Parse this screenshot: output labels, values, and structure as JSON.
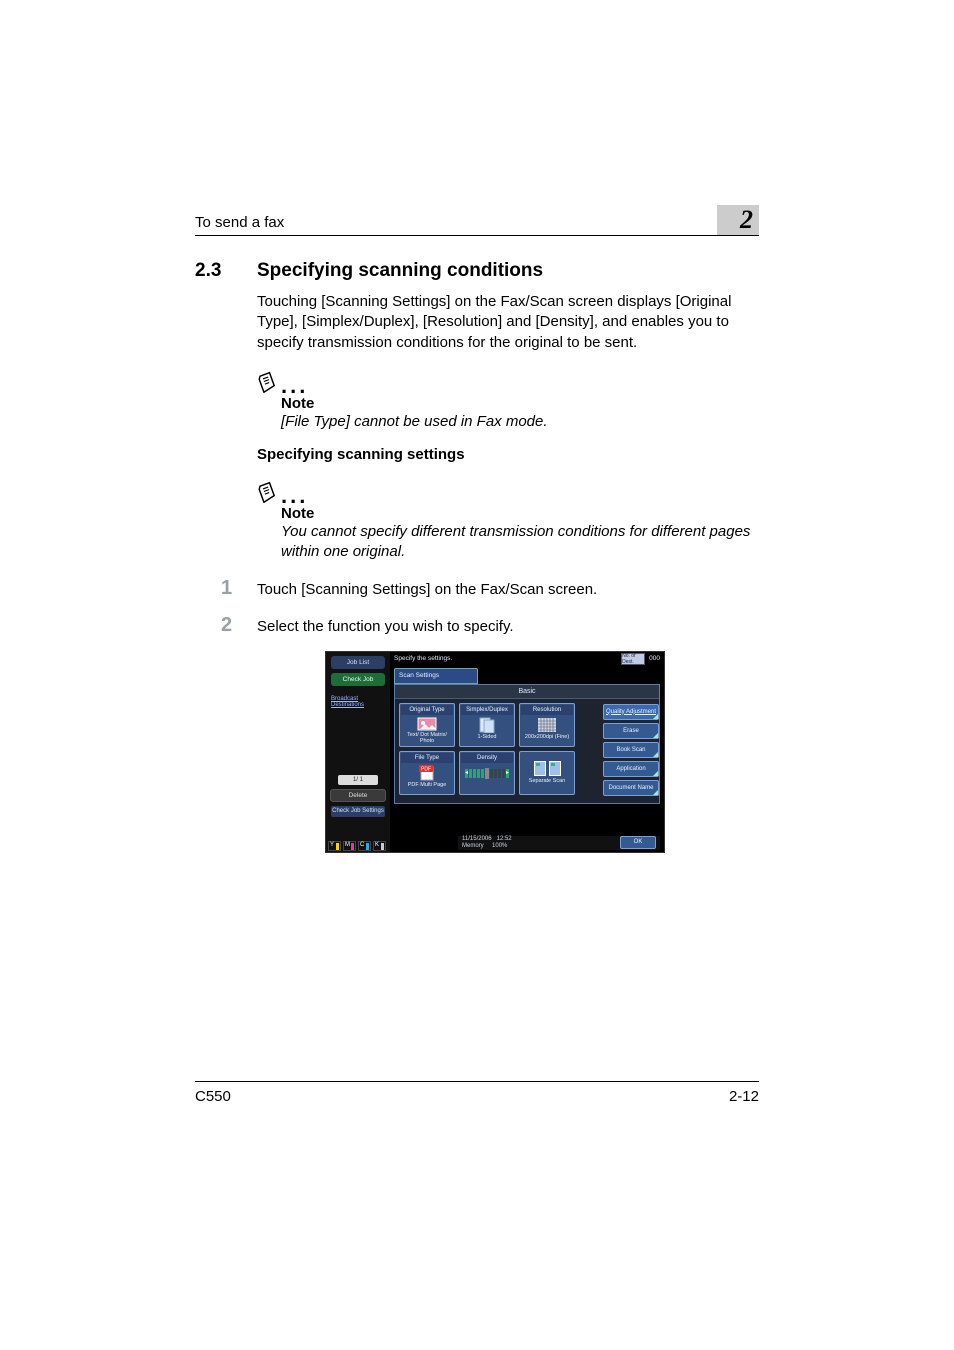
{
  "header": {
    "running_title": "To send a fax",
    "chapter_number": "2"
  },
  "section": {
    "number": "2.3",
    "title": "Specifying scanning conditions"
  },
  "intro_paragraph": "Touching [Scanning Settings] on the Fax/Scan screen displays [Original Type], [Simplex/Duplex], [Resolution] and [Density], and enables you to specify transmission conditions for the original to be sent.",
  "note1": {
    "label": "Note",
    "body": "[File Type] cannot be used in Fax mode."
  },
  "subheading": "Specifying scanning settings",
  "note2": {
    "label": "Note",
    "body": "You cannot specify different transmission conditions for different pages within one original."
  },
  "steps": [
    {
      "n": "1",
      "text": "Touch [Scanning Settings] on the Fax/Scan screen."
    },
    {
      "n": "2",
      "text": "Select the function you wish to specify."
    }
  ],
  "ui": {
    "left": {
      "job_list": "Job List",
      "check_job": "Check Job",
      "broadcast_label": "Broadcast Destinations",
      "page_indicator": "1/  1",
      "delete": "Delete",
      "check_settings": "Check Job Settings",
      "supplies": [
        "Y",
        "M",
        "C",
        "K"
      ]
    },
    "top": {
      "message": "Specify the settings.",
      "dest_indicator": "No. of Dest.",
      "count": "000"
    },
    "tab": "Scan Settings",
    "basic": "Basic",
    "tiles": {
      "original_type": {
        "label": "Original Type",
        "value": "Text/ Dot Matrix/ Photo"
      },
      "simplex_duplex": {
        "label": "Simplex/Duplex",
        "value": "1-Sided"
      },
      "resolution": {
        "label": "Resolution",
        "value": "200x200dpi (Fine)"
      },
      "file_type": {
        "label": "File Type",
        "value": "PDF Multi Page"
      },
      "density": {
        "label": "Density"
      },
      "separate_scan": {
        "label": "Separate Scan"
      }
    },
    "side_buttons": {
      "quality": "Quality Adjustment",
      "erase": "Erase",
      "book_scan": "Book Scan",
      "application": "Application",
      "document_name": "Document Name"
    },
    "bottom": {
      "date": "11/15/2006",
      "time": "12:52",
      "memory_label": "Memory",
      "memory_value": "100%",
      "ok": "OK"
    }
  },
  "footer": {
    "model": "C550",
    "page": "2-12"
  }
}
